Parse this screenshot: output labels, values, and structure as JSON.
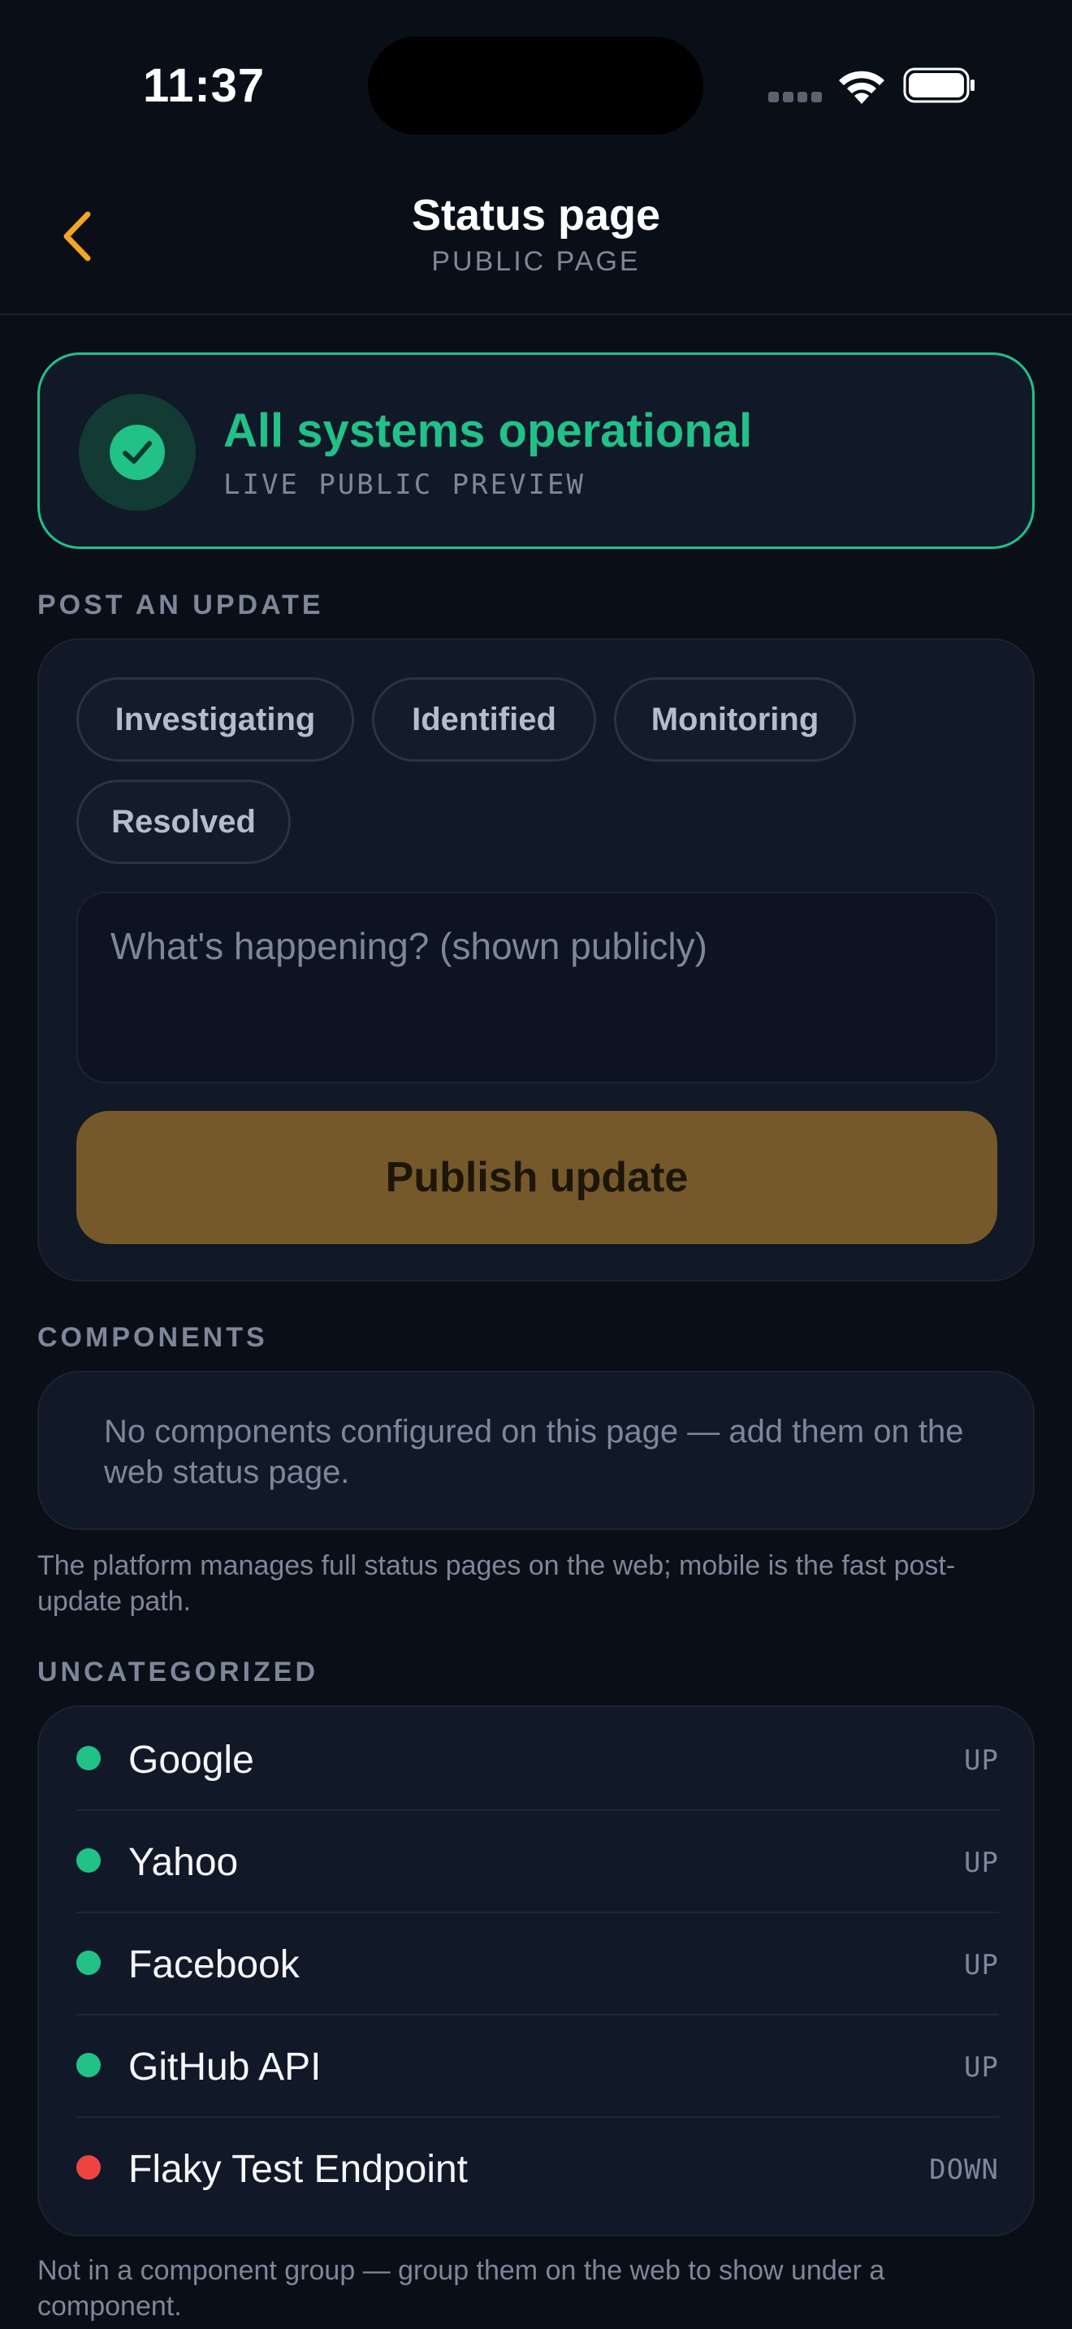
{
  "status_bar": {
    "time": "11:37"
  },
  "nav": {
    "title": "Status page",
    "subtitle": "PUBLIC PAGE"
  },
  "status_card": {
    "title": "All systems operational",
    "subtitle": "LIVE PUBLIC PREVIEW",
    "color": "#21c188"
  },
  "post_update": {
    "section_label": "POST AN UPDATE",
    "chips": [
      "Investigating",
      "Identified",
      "Monitoring",
      "Resolved"
    ],
    "placeholder": "What's happening? (shown publicly)",
    "publish_label": "Publish update"
  },
  "components": {
    "section_label": "COMPONENTS",
    "empty_text": "No components configured on this page — add them on the web status page.",
    "note": "The platform manages full status pages on the web; mobile is the fast post-update path."
  },
  "uncategorized": {
    "section_label": "UNCATEGORIZED",
    "monitors": [
      {
        "name": "Google",
        "state": "UP",
        "color": "#21c188"
      },
      {
        "name": "Yahoo",
        "state": "UP",
        "color": "#21c188"
      },
      {
        "name": "Facebook",
        "state": "UP",
        "color": "#21c188"
      },
      {
        "name": "GitHub API",
        "state": "UP",
        "color": "#21c188"
      },
      {
        "name": "Flaky Test Endpoint",
        "state": "DOWN",
        "color": "#ef4444"
      }
    ],
    "note": "Not in a component group — group them on the web to show under a component."
  },
  "colors": {
    "accent": "#f5a524",
    "background": "#0a0e17",
    "card": "#111827"
  }
}
